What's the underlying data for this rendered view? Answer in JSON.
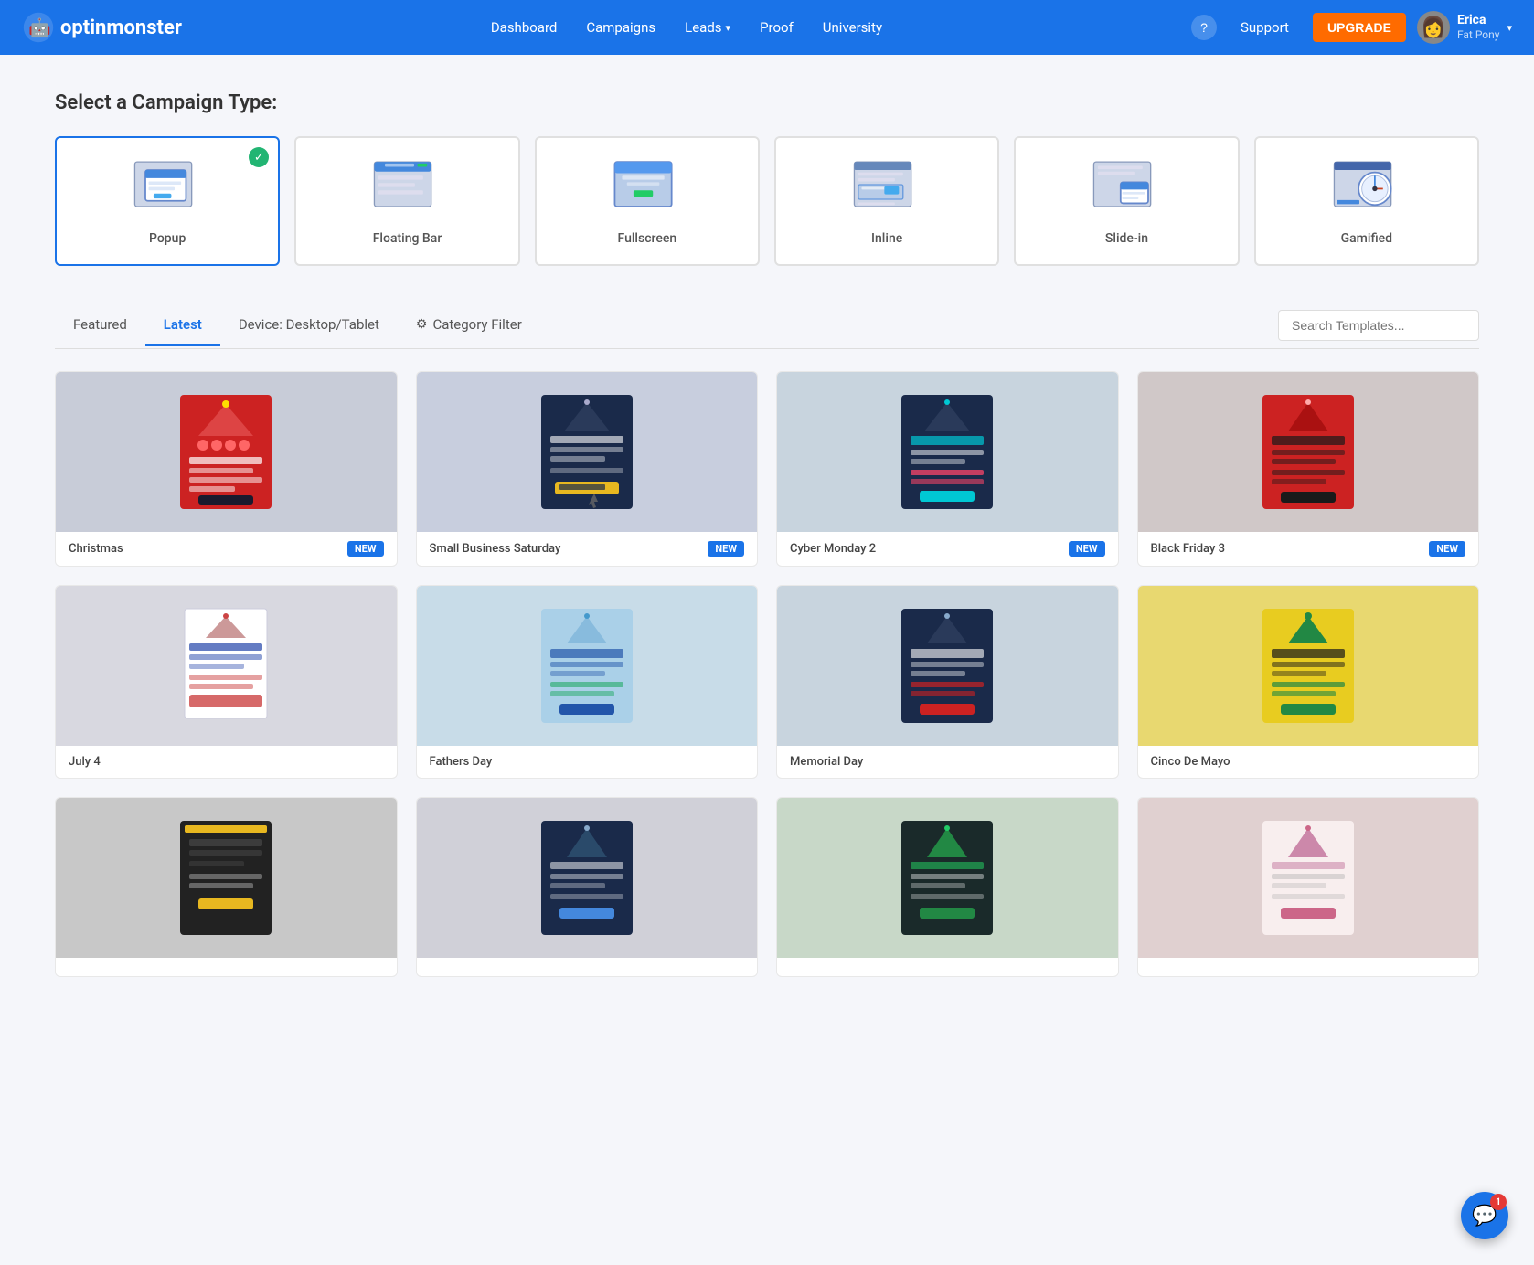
{
  "navbar": {
    "logo_text": "optinmonster",
    "links": [
      {
        "id": "dashboard",
        "label": "Dashboard",
        "has_dropdown": false
      },
      {
        "id": "campaigns",
        "label": "Campaigns",
        "has_dropdown": false
      },
      {
        "id": "leads",
        "label": "Leads",
        "has_dropdown": true
      },
      {
        "id": "proof",
        "label": "Proof",
        "has_dropdown": false
      },
      {
        "id": "university",
        "label": "University",
        "has_dropdown": false
      }
    ],
    "support_label": "Support",
    "upgrade_label": "UPGRADE",
    "user_name": "Erica",
    "user_sub": "Fat Pony"
  },
  "page": {
    "section_title": "Select a Campaign Type:",
    "campaign_types": [
      {
        "id": "popup",
        "label": "Popup",
        "selected": true
      },
      {
        "id": "floating-bar",
        "label": "Floating Bar",
        "selected": false
      },
      {
        "id": "fullscreen",
        "label": "Fullscreen",
        "selected": false
      },
      {
        "id": "inline",
        "label": "Inline",
        "selected": false
      },
      {
        "id": "slide-in",
        "label": "Slide-in",
        "selected": false
      },
      {
        "id": "gamified",
        "label": "Gamified",
        "selected": false
      }
    ]
  },
  "tabs": {
    "items": [
      {
        "id": "featured",
        "label": "Featured",
        "active": false
      },
      {
        "id": "latest",
        "label": "Latest",
        "active": true
      },
      {
        "id": "device",
        "label": "Device: Desktop/Tablet",
        "active": false
      },
      {
        "id": "category",
        "label": "Category Filter",
        "active": false
      }
    ],
    "search_placeholder": "Search Templates..."
  },
  "templates": {
    "row1": [
      {
        "id": "christmas",
        "name": "Christmas",
        "badge": "NEW",
        "bg": "#c0c8d8",
        "accent": "#cc2222",
        "accent2": "#1a1a2e"
      },
      {
        "id": "small-business-saturday",
        "name": "Small Business Saturday",
        "badge": "NEW",
        "bg": "#c8cede",
        "accent": "#1a2a4a",
        "accent2": "#e8b820"
      },
      {
        "id": "cyber-monday-2",
        "name": "Cyber Monday 2",
        "badge": "NEW",
        "bg": "#c8d4de",
        "accent": "#00c8d4",
        "accent2": "#1a2a4a"
      },
      {
        "id": "black-friday-3",
        "name": "Black Friday 3",
        "badge": "NEW",
        "bg": "#d0c8c8",
        "accent": "#cc2222",
        "accent2": "#1a1a1a"
      }
    ],
    "row2": [
      {
        "id": "july-4",
        "name": "July 4",
        "badge": "",
        "bg": "#d8d8e0",
        "accent": "#cc4444",
        "accent2": "#2244aa"
      },
      {
        "id": "fathers-day",
        "name": "Fathers Day",
        "badge": "",
        "bg": "#c8dce8",
        "accent": "#44aacc",
        "accent2": "#2255aa"
      },
      {
        "id": "memorial-day",
        "name": "Memorial Day",
        "badge": "",
        "bg": "#c8d4de",
        "accent": "#cc2222",
        "accent2": "#1a2a4a"
      },
      {
        "id": "cinco-de-mayo",
        "name": "Cinco De Mayo",
        "badge": "",
        "bg": "#e8d870",
        "accent": "#228844",
        "accent2": "#1a1a1a"
      }
    ],
    "row3": [
      {
        "id": "template-9",
        "name": "",
        "badge": "",
        "bg": "#c8c8c8",
        "accent": "#e8b820",
        "accent2": "#1a1a1a"
      },
      {
        "id": "template-10",
        "name": "",
        "badge": "",
        "bg": "#d0d0d8",
        "accent": "#1a2a4a",
        "accent2": "#333"
      },
      {
        "id": "template-11",
        "name": "",
        "badge": "",
        "bg": "#c8d8c8",
        "accent": "#228844",
        "accent2": "#1a2a2a"
      },
      {
        "id": "template-12",
        "name": "",
        "badge": "",
        "bg": "#e0d0d0",
        "accent": "#cc88aa",
        "accent2": "#ffffff"
      }
    ]
  },
  "fab": {
    "badge_count": "1"
  }
}
